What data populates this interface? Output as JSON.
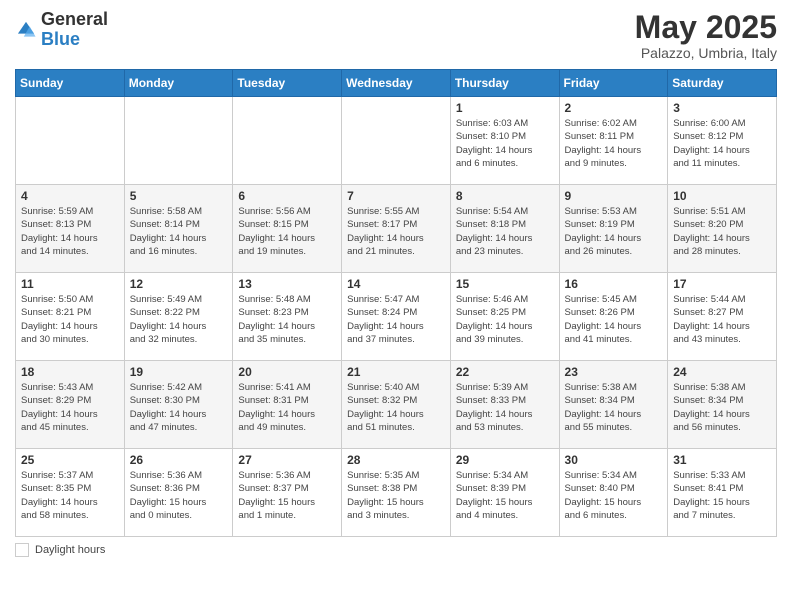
{
  "header": {
    "logo_general": "General",
    "logo_blue": "Blue",
    "month": "May 2025",
    "location": "Palazzo, Umbria, Italy"
  },
  "days_of_week": [
    "Sunday",
    "Monday",
    "Tuesday",
    "Wednesday",
    "Thursday",
    "Friday",
    "Saturday"
  ],
  "footer": {
    "label": "Daylight hours"
  },
  "weeks": [
    {
      "days": [
        {
          "num": "",
          "info": ""
        },
        {
          "num": "",
          "info": ""
        },
        {
          "num": "",
          "info": ""
        },
        {
          "num": "",
          "info": ""
        },
        {
          "num": "1",
          "info": "Sunrise: 6:03 AM\nSunset: 8:10 PM\nDaylight: 14 hours\nand 6 minutes."
        },
        {
          "num": "2",
          "info": "Sunrise: 6:02 AM\nSunset: 8:11 PM\nDaylight: 14 hours\nand 9 minutes."
        },
        {
          "num": "3",
          "info": "Sunrise: 6:00 AM\nSunset: 8:12 PM\nDaylight: 14 hours\nand 11 minutes."
        }
      ]
    },
    {
      "days": [
        {
          "num": "4",
          "info": "Sunrise: 5:59 AM\nSunset: 8:13 PM\nDaylight: 14 hours\nand 14 minutes."
        },
        {
          "num": "5",
          "info": "Sunrise: 5:58 AM\nSunset: 8:14 PM\nDaylight: 14 hours\nand 16 minutes."
        },
        {
          "num": "6",
          "info": "Sunrise: 5:56 AM\nSunset: 8:15 PM\nDaylight: 14 hours\nand 19 minutes."
        },
        {
          "num": "7",
          "info": "Sunrise: 5:55 AM\nSunset: 8:17 PM\nDaylight: 14 hours\nand 21 minutes."
        },
        {
          "num": "8",
          "info": "Sunrise: 5:54 AM\nSunset: 8:18 PM\nDaylight: 14 hours\nand 23 minutes."
        },
        {
          "num": "9",
          "info": "Sunrise: 5:53 AM\nSunset: 8:19 PM\nDaylight: 14 hours\nand 26 minutes."
        },
        {
          "num": "10",
          "info": "Sunrise: 5:51 AM\nSunset: 8:20 PM\nDaylight: 14 hours\nand 28 minutes."
        }
      ]
    },
    {
      "days": [
        {
          "num": "11",
          "info": "Sunrise: 5:50 AM\nSunset: 8:21 PM\nDaylight: 14 hours\nand 30 minutes."
        },
        {
          "num": "12",
          "info": "Sunrise: 5:49 AM\nSunset: 8:22 PM\nDaylight: 14 hours\nand 32 minutes."
        },
        {
          "num": "13",
          "info": "Sunrise: 5:48 AM\nSunset: 8:23 PM\nDaylight: 14 hours\nand 35 minutes."
        },
        {
          "num": "14",
          "info": "Sunrise: 5:47 AM\nSunset: 8:24 PM\nDaylight: 14 hours\nand 37 minutes."
        },
        {
          "num": "15",
          "info": "Sunrise: 5:46 AM\nSunset: 8:25 PM\nDaylight: 14 hours\nand 39 minutes."
        },
        {
          "num": "16",
          "info": "Sunrise: 5:45 AM\nSunset: 8:26 PM\nDaylight: 14 hours\nand 41 minutes."
        },
        {
          "num": "17",
          "info": "Sunrise: 5:44 AM\nSunset: 8:27 PM\nDaylight: 14 hours\nand 43 minutes."
        }
      ]
    },
    {
      "days": [
        {
          "num": "18",
          "info": "Sunrise: 5:43 AM\nSunset: 8:29 PM\nDaylight: 14 hours\nand 45 minutes."
        },
        {
          "num": "19",
          "info": "Sunrise: 5:42 AM\nSunset: 8:30 PM\nDaylight: 14 hours\nand 47 minutes."
        },
        {
          "num": "20",
          "info": "Sunrise: 5:41 AM\nSunset: 8:31 PM\nDaylight: 14 hours\nand 49 minutes."
        },
        {
          "num": "21",
          "info": "Sunrise: 5:40 AM\nSunset: 8:32 PM\nDaylight: 14 hours\nand 51 minutes."
        },
        {
          "num": "22",
          "info": "Sunrise: 5:39 AM\nSunset: 8:33 PM\nDaylight: 14 hours\nand 53 minutes."
        },
        {
          "num": "23",
          "info": "Sunrise: 5:38 AM\nSunset: 8:34 PM\nDaylight: 14 hours\nand 55 minutes."
        },
        {
          "num": "24",
          "info": "Sunrise: 5:38 AM\nSunset: 8:34 PM\nDaylight: 14 hours\nand 56 minutes."
        }
      ]
    },
    {
      "days": [
        {
          "num": "25",
          "info": "Sunrise: 5:37 AM\nSunset: 8:35 PM\nDaylight: 14 hours\nand 58 minutes."
        },
        {
          "num": "26",
          "info": "Sunrise: 5:36 AM\nSunset: 8:36 PM\nDaylight: 15 hours\nand 0 minutes."
        },
        {
          "num": "27",
          "info": "Sunrise: 5:36 AM\nSunset: 8:37 PM\nDaylight: 15 hours\nand 1 minute."
        },
        {
          "num": "28",
          "info": "Sunrise: 5:35 AM\nSunset: 8:38 PM\nDaylight: 15 hours\nand 3 minutes."
        },
        {
          "num": "29",
          "info": "Sunrise: 5:34 AM\nSunset: 8:39 PM\nDaylight: 15 hours\nand 4 minutes."
        },
        {
          "num": "30",
          "info": "Sunrise: 5:34 AM\nSunset: 8:40 PM\nDaylight: 15 hours\nand 6 minutes."
        },
        {
          "num": "31",
          "info": "Sunrise: 5:33 AM\nSunset: 8:41 PM\nDaylight: 15 hours\nand 7 minutes."
        }
      ]
    }
  ]
}
